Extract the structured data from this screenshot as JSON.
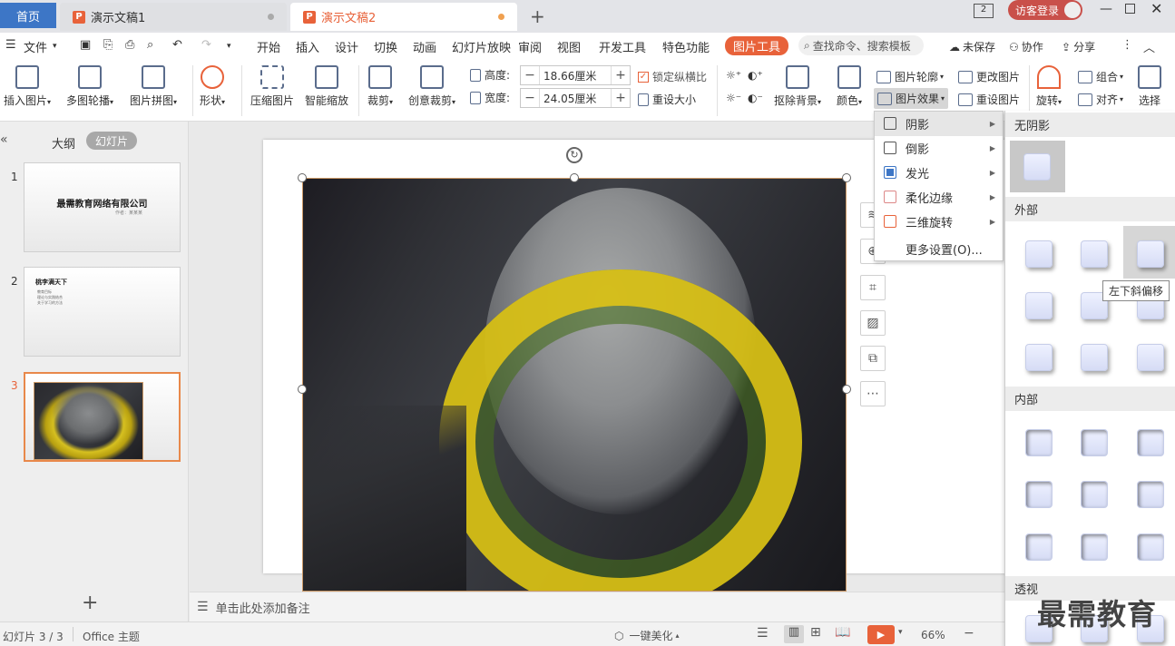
{
  "tabs": {
    "home": "首页",
    "doc1": "演示文稿1",
    "doc2": "演示文稿2",
    "page_indicator": "2",
    "login": "访客登录"
  },
  "menubar": {
    "file": "文件",
    "items": [
      "开始",
      "插入",
      "设计",
      "切换",
      "动画",
      "幻灯片放映",
      "审阅",
      "视图",
      "开发工具",
      "特色功能"
    ],
    "picture_tools": "图片工具",
    "search": "查找命令、搜索模板",
    "unsaved": "未保存",
    "collab": "协作",
    "share": "分享"
  },
  "ribbon": {
    "insert_picture": "插入图片",
    "multi_carousel": "多图轮播",
    "picture_collage": "图片拼图",
    "shape": "形状",
    "compress": "压缩图片",
    "smart_zoom": "智能缩放",
    "crop": "裁剪",
    "creative_crop": "创意裁剪",
    "height_label": "高度:",
    "height_value": "18.66厘米",
    "width_label": "宽度:",
    "width_value": "24.05厘米",
    "lock_ratio": "锁定纵横比",
    "reset_size": "重设大小",
    "remove_bg": "抠除背景",
    "color": "颜色",
    "outline": "图片轮廓",
    "effects": "图片效果",
    "change_picture": "更改图片",
    "reset_picture": "重设图片",
    "rotate": "旋转",
    "group": "组合",
    "align": "对齐",
    "select": "选择"
  },
  "leftpanel": {
    "outline_tab": "大纲",
    "slides_tab": "幻灯片",
    "slide1_title": "最需教育网络有限公司",
    "slide1_sub": "作者：某某某",
    "slide2_title": "桃李满天下",
    "slide2_bullets": [
      "教育目标",
      "理论与实践结合",
      "关于学习的方法"
    ],
    "nums": [
      "1",
      "2",
      "3"
    ]
  },
  "notes": {
    "placeholder": "单击此处添加备注"
  },
  "status": {
    "slide_count": "幻灯片 3 / 3",
    "theme": "Office 主题",
    "beautify": "一键美化",
    "zoom": "66%"
  },
  "dropmenu": {
    "items": [
      "阴影",
      "倒影",
      "发光",
      "柔化边缘",
      "三维旋转"
    ],
    "more": "更多设置(O)..."
  },
  "gallery": {
    "no_shadow": "无阴影",
    "outer": "外部",
    "inner": "内部",
    "perspective": "透视",
    "tooltip": "左下斜偏移"
  },
  "watermark": "最需教育",
  "colors": {
    "accent_orange": "#e8623a",
    "home_tab": "#3d76c6",
    "login_btn": "#c9504a"
  }
}
